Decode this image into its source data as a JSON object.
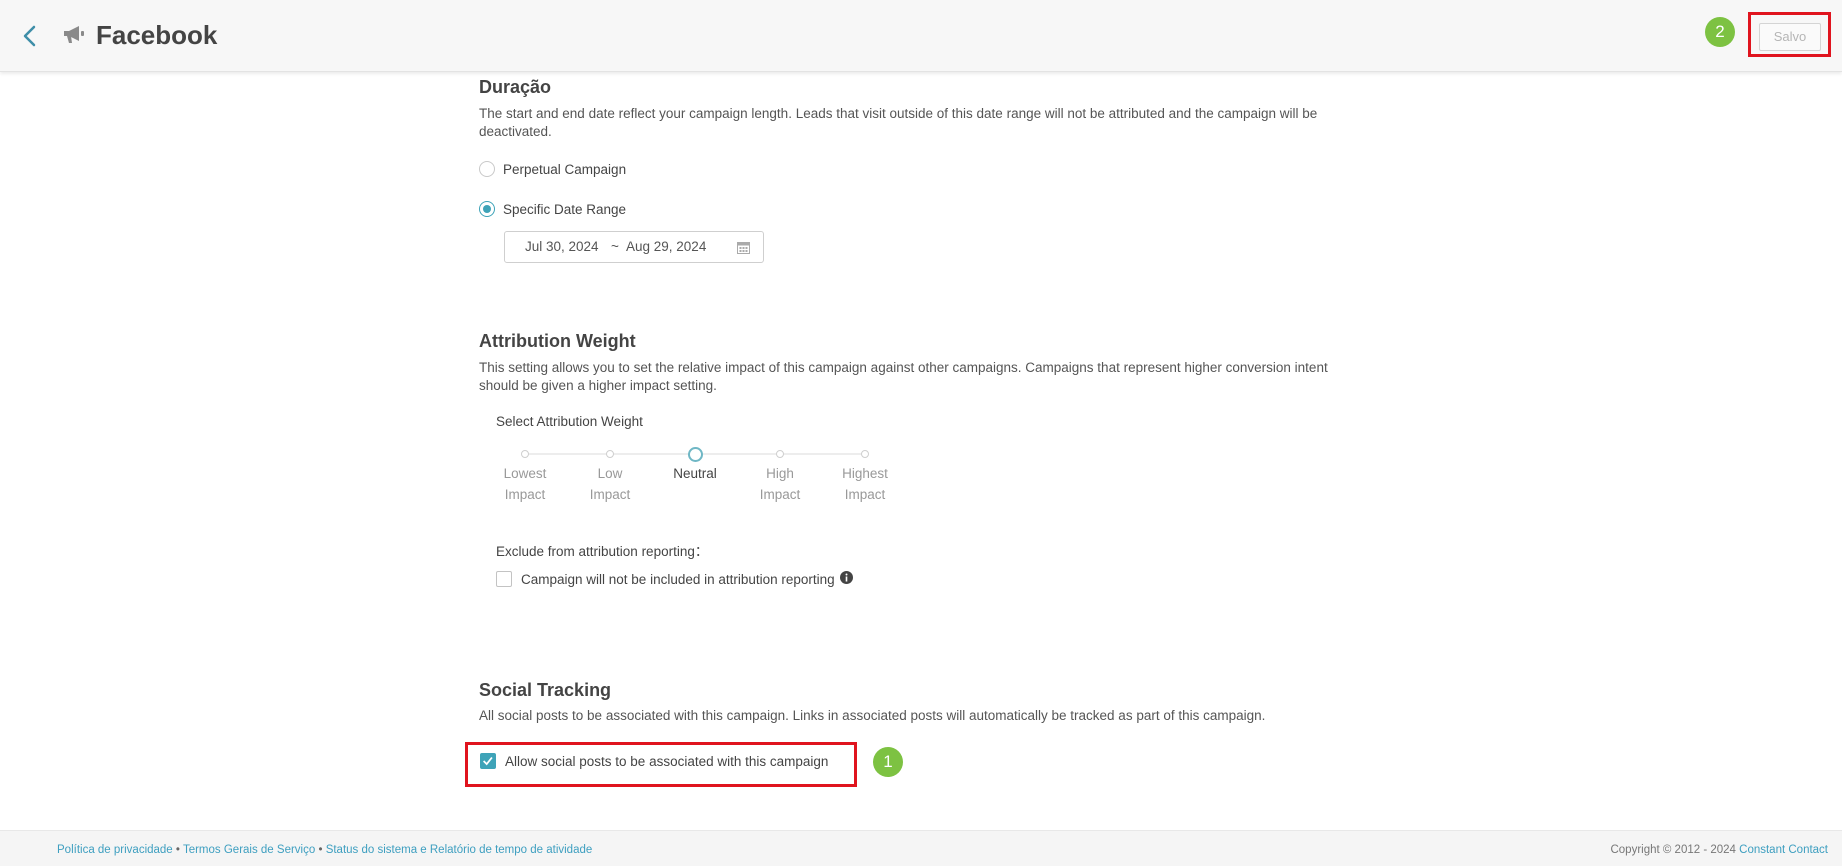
{
  "header": {
    "title": "Facebook",
    "save_label": "Salvo",
    "badge_2": "2"
  },
  "duration": {
    "heading": "Duração",
    "description": "The start and end date reflect your campaign length. Leads that visit outside of this date range will not be attributed and the campaign will be deactivated.",
    "options": [
      {
        "label": "Perpetual Campaign",
        "selected": false
      },
      {
        "label": "Specific Date Range",
        "selected": true
      }
    ],
    "start_date": "Jul 30, 2024",
    "range_sep": "~",
    "end_date": "Aug 29, 2024"
  },
  "attribution": {
    "heading": "Attribution Weight",
    "description": "This setting allows you to set the relative impact of this campaign against other campaigns. Campaigns that represent higher conversion intent should be given a higher impact setting.",
    "select_label": "Select Attribution Weight",
    "levels": [
      {
        "label": "Lowest\nImpact"
      },
      {
        "label": "Low\nImpact"
      },
      {
        "label": "Neutral"
      },
      {
        "label": "High\nImpact"
      },
      {
        "label": "Highest\nImpact"
      }
    ],
    "selected_level": 2,
    "exclude_label": "Exclude from attribution reporting：",
    "exclude_checkbox_label": "Campaign will not be included in attribution reporting",
    "exclude_checked": false
  },
  "social": {
    "heading": "Social Tracking",
    "description": "All social posts to be associated with this campaign. Links in associated posts will automatically be tracked as part of this campaign.",
    "checkbox_label": "Allow social posts to be associated with this campaign",
    "checked": true,
    "badge_1": "1"
  },
  "footer": {
    "privacy": "Política de privacidade",
    "terms": "Termos Gerais de Serviço",
    "status": "Status do sistema e Relatório de tempo de atividade",
    "separator": "•",
    "copyright": "Copyright © 2012 - 2024",
    "company": "Constant Contact"
  },
  "colors": {
    "accent": "#3ea3b8",
    "badge": "#7dc242",
    "highlight": "#e0141e",
    "link": "#3e9fc0"
  }
}
